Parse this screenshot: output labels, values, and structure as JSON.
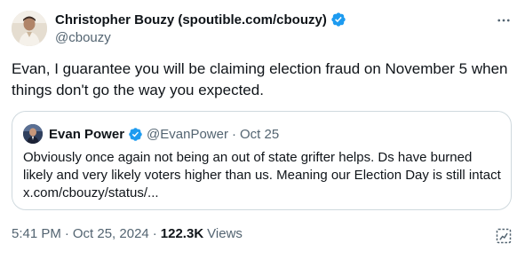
{
  "author": {
    "name": "Christopher Bouzy (spoutible.com/cbouzy)",
    "handle": "@cbouzy",
    "verified": true
  },
  "tweet": {
    "text": "Evan, I guarantee you will be claiming election fraud on November 5 when things don't go the way you expected."
  },
  "quoted": {
    "name": "Evan Power",
    "handle": "@EvanPower",
    "separator": "·",
    "time": "Oct 25",
    "text": "Obviously once again not being an out of state grifter helps. Ds have burned likely and very likely voters higher than us. Meaning our Election Day is still intact x.com/cbouzy/status/..."
  },
  "meta": {
    "time": "5:41 PM",
    "sep1": "·",
    "date": "Oct 25, 2024",
    "sep2": "·",
    "views_count": "122.3K",
    "views_label": "Views"
  },
  "colors": {
    "verified": "#1d9bf0",
    "secondary_text": "#536471",
    "primary_text": "#0f1419",
    "border": "#cfd9de"
  },
  "icons": {
    "verified": "verified-badge-icon",
    "more": "more-horizontal-icon",
    "grok": "grok-analysis-icon"
  }
}
